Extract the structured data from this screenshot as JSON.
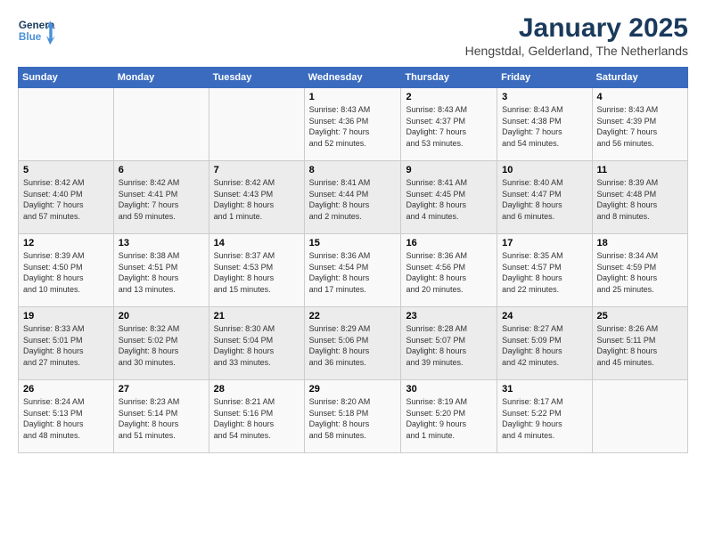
{
  "logo": {
    "line1": "General",
    "line2": "Blue"
  },
  "header": {
    "month": "January 2025",
    "location": "Hengstdal, Gelderland, The Netherlands"
  },
  "weekdays": [
    "Sunday",
    "Monday",
    "Tuesday",
    "Wednesday",
    "Thursday",
    "Friday",
    "Saturday"
  ],
  "weeks": [
    [
      {
        "day": "",
        "detail": ""
      },
      {
        "day": "",
        "detail": ""
      },
      {
        "day": "",
        "detail": ""
      },
      {
        "day": "1",
        "detail": "Sunrise: 8:43 AM\nSunset: 4:36 PM\nDaylight: 7 hours\nand 52 minutes."
      },
      {
        "day": "2",
        "detail": "Sunrise: 8:43 AM\nSunset: 4:37 PM\nDaylight: 7 hours\nand 53 minutes."
      },
      {
        "day": "3",
        "detail": "Sunrise: 8:43 AM\nSunset: 4:38 PM\nDaylight: 7 hours\nand 54 minutes."
      },
      {
        "day": "4",
        "detail": "Sunrise: 8:43 AM\nSunset: 4:39 PM\nDaylight: 7 hours\nand 56 minutes."
      }
    ],
    [
      {
        "day": "5",
        "detail": "Sunrise: 8:42 AM\nSunset: 4:40 PM\nDaylight: 7 hours\nand 57 minutes."
      },
      {
        "day": "6",
        "detail": "Sunrise: 8:42 AM\nSunset: 4:41 PM\nDaylight: 7 hours\nand 59 minutes."
      },
      {
        "day": "7",
        "detail": "Sunrise: 8:42 AM\nSunset: 4:43 PM\nDaylight: 8 hours\nand 1 minute."
      },
      {
        "day": "8",
        "detail": "Sunrise: 8:41 AM\nSunset: 4:44 PM\nDaylight: 8 hours\nand 2 minutes."
      },
      {
        "day": "9",
        "detail": "Sunrise: 8:41 AM\nSunset: 4:45 PM\nDaylight: 8 hours\nand 4 minutes."
      },
      {
        "day": "10",
        "detail": "Sunrise: 8:40 AM\nSunset: 4:47 PM\nDaylight: 8 hours\nand 6 minutes."
      },
      {
        "day": "11",
        "detail": "Sunrise: 8:39 AM\nSunset: 4:48 PM\nDaylight: 8 hours\nand 8 minutes."
      }
    ],
    [
      {
        "day": "12",
        "detail": "Sunrise: 8:39 AM\nSunset: 4:50 PM\nDaylight: 8 hours\nand 10 minutes."
      },
      {
        "day": "13",
        "detail": "Sunrise: 8:38 AM\nSunset: 4:51 PM\nDaylight: 8 hours\nand 13 minutes."
      },
      {
        "day": "14",
        "detail": "Sunrise: 8:37 AM\nSunset: 4:53 PM\nDaylight: 8 hours\nand 15 minutes."
      },
      {
        "day": "15",
        "detail": "Sunrise: 8:36 AM\nSunset: 4:54 PM\nDaylight: 8 hours\nand 17 minutes."
      },
      {
        "day": "16",
        "detail": "Sunrise: 8:36 AM\nSunset: 4:56 PM\nDaylight: 8 hours\nand 20 minutes."
      },
      {
        "day": "17",
        "detail": "Sunrise: 8:35 AM\nSunset: 4:57 PM\nDaylight: 8 hours\nand 22 minutes."
      },
      {
        "day": "18",
        "detail": "Sunrise: 8:34 AM\nSunset: 4:59 PM\nDaylight: 8 hours\nand 25 minutes."
      }
    ],
    [
      {
        "day": "19",
        "detail": "Sunrise: 8:33 AM\nSunset: 5:01 PM\nDaylight: 8 hours\nand 27 minutes."
      },
      {
        "day": "20",
        "detail": "Sunrise: 8:32 AM\nSunset: 5:02 PM\nDaylight: 8 hours\nand 30 minutes."
      },
      {
        "day": "21",
        "detail": "Sunrise: 8:30 AM\nSunset: 5:04 PM\nDaylight: 8 hours\nand 33 minutes."
      },
      {
        "day": "22",
        "detail": "Sunrise: 8:29 AM\nSunset: 5:06 PM\nDaylight: 8 hours\nand 36 minutes."
      },
      {
        "day": "23",
        "detail": "Sunrise: 8:28 AM\nSunset: 5:07 PM\nDaylight: 8 hours\nand 39 minutes."
      },
      {
        "day": "24",
        "detail": "Sunrise: 8:27 AM\nSunset: 5:09 PM\nDaylight: 8 hours\nand 42 minutes."
      },
      {
        "day": "25",
        "detail": "Sunrise: 8:26 AM\nSunset: 5:11 PM\nDaylight: 8 hours\nand 45 minutes."
      }
    ],
    [
      {
        "day": "26",
        "detail": "Sunrise: 8:24 AM\nSunset: 5:13 PM\nDaylight: 8 hours\nand 48 minutes."
      },
      {
        "day": "27",
        "detail": "Sunrise: 8:23 AM\nSunset: 5:14 PM\nDaylight: 8 hours\nand 51 minutes."
      },
      {
        "day": "28",
        "detail": "Sunrise: 8:21 AM\nSunset: 5:16 PM\nDaylight: 8 hours\nand 54 minutes."
      },
      {
        "day": "29",
        "detail": "Sunrise: 8:20 AM\nSunset: 5:18 PM\nDaylight: 8 hours\nand 58 minutes."
      },
      {
        "day": "30",
        "detail": "Sunrise: 8:19 AM\nSunset: 5:20 PM\nDaylight: 9 hours\nand 1 minute."
      },
      {
        "day": "31",
        "detail": "Sunrise: 8:17 AM\nSunset: 5:22 PM\nDaylight: 9 hours\nand 4 minutes."
      },
      {
        "day": "",
        "detail": ""
      }
    ]
  ]
}
